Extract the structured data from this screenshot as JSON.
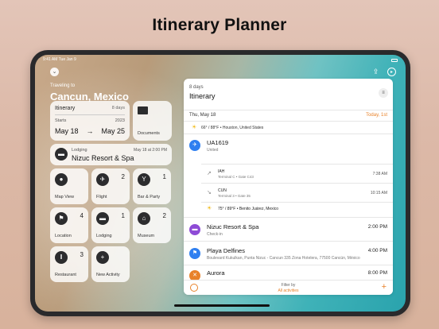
{
  "headline": "Itinerary Planner",
  "statusbar": {
    "time": "9:41 AM",
    "date": "Tue Jan 9"
  },
  "sidebar": {
    "traveling_to": "Traveling to",
    "destination": "Cancun, Mexico",
    "itinerary_card": {
      "title": "Itinerary",
      "days": "8 days",
      "starts_label": "Starts",
      "year": "2023",
      "start_date": "May 18",
      "arrow": "→",
      "end_date": "May 25"
    },
    "documents_label": "Documents",
    "lodging_card": {
      "label": "Lodging",
      "name": "Nizuc Resort & Spa",
      "date": "May 18 at 2:00 PM"
    },
    "tiles": [
      {
        "label": "Map View",
        "count": "",
        "icon": "map-pin-icon"
      },
      {
        "label": "Flight",
        "count": "2",
        "icon": "airplane-icon"
      },
      {
        "label": "Bar & Party",
        "count": "1",
        "icon": "cocktail-icon"
      },
      {
        "label": "Location",
        "count": "4",
        "icon": "flag-icon"
      },
      {
        "label": "Lodging",
        "count": "1",
        "icon": "bed-icon"
      },
      {
        "label": "Museum",
        "count": "2",
        "icon": "museum-icon"
      },
      {
        "label": "Restaurant",
        "count": "3",
        "icon": "utensils-icon"
      },
      {
        "label": "New Activity",
        "count": "",
        "icon": "plus-icon"
      }
    ]
  },
  "panel": {
    "days": "8 days",
    "title": "Itinerary",
    "day_label": "Thu, May 18",
    "day_right": "Today, 1st",
    "weather1": "66° / 88°F • Houston, United States",
    "flight": {
      "title": "UA1619",
      "subtitle": "United"
    },
    "dep": {
      "code": "IAH",
      "detail": "Terminal C • Gate C43",
      "time": "7:38 AM"
    },
    "arr": {
      "code": "CUN",
      "detail": "Terminal 3 • Gate 35",
      "time": "10:15 AM"
    },
    "weather2": "75° / 89°F • Benito Juárez, Mexico",
    "hotel": {
      "title": "Nizuc Resort & Spa",
      "subtitle": "Check-in",
      "time": "2:00 PM"
    },
    "beach": {
      "title": "Playa Delfines",
      "subtitle": "Boulevard Kukulkan, Punta Nizuc - Cancun 335 Zona Hotelera, 77500 Cancún, México",
      "time": "4:00 PM"
    },
    "aurora": {
      "title": "Aurora",
      "time": "8:00 PM"
    },
    "filter_label": "Filter by",
    "filter_value": "All activities"
  },
  "colors": {
    "accent": "#e8822a",
    "flight": "#2f7ff0",
    "hotel": "#8e4bd6",
    "beach": "#2f7ff0",
    "aurora": "#e8822a"
  }
}
